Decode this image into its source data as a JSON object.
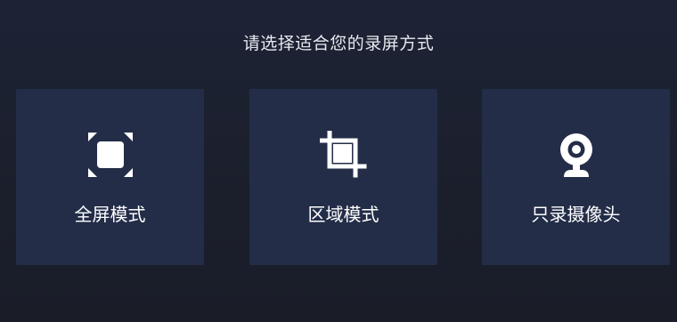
{
  "page": {
    "title": "请选择适合您的录屏方式"
  },
  "modes": [
    {
      "label": "全屏模式",
      "icon": "fullscreen-icon"
    },
    {
      "label": "区域模式",
      "icon": "crop-icon"
    },
    {
      "label": "只录摄像头",
      "icon": "webcam-icon"
    }
  ],
  "colors": {
    "background": "#1d2335",
    "card": "#232d48",
    "text": "#ffffff"
  }
}
